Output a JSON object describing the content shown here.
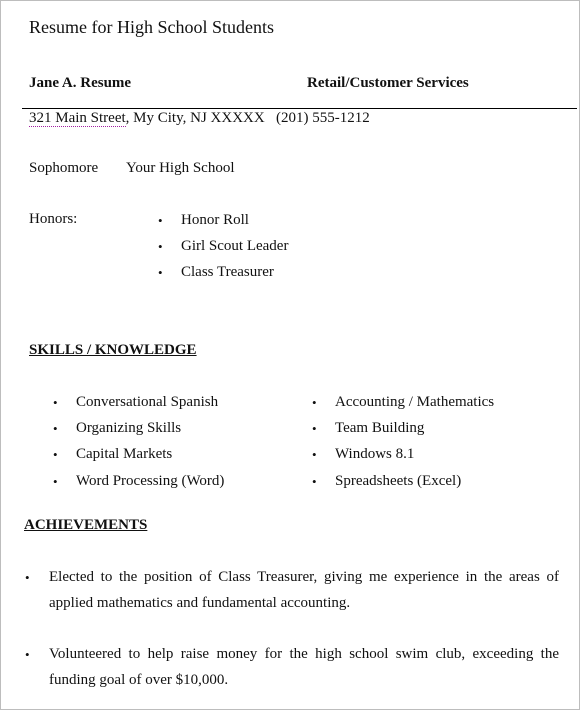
{
  "document": {
    "title": "Resume for High School Students",
    "name": "Jane A. Resume",
    "target_role": "Retail/Customer Services",
    "address": {
      "street": "321 Main Street",
      "rest": ", My City, NJ XXXXX",
      "phone": "(201) 555-1212"
    },
    "grade": "Sophomore",
    "school": "Your High School",
    "honors": {
      "label": "Honors:",
      "items": [
        "Honor Roll",
        "Girl Scout Leader",
        "Class Treasurer"
      ]
    },
    "skills": {
      "heading": "SKILLS / KNOWLEDGE",
      "left": [
        "Conversational Spanish",
        "Organizing Skills",
        "Capital Markets",
        "Word Processing (Word)"
      ],
      "right": [
        "Accounting / Mathematics",
        "Team Building",
        "Windows 8.1",
        "Spreadsheets (Excel)"
      ]
    },
    "achievements": {
      "heading": "ACHIEVEMENTS",
      "items": [
        "Elected to the position of Class Treasurer, giving me experience in the areas of applied mathematics and fundamental accounting.",
        "Volunteered to help raise money for the high school swim club, exceeding the funding goal of over $10,000."
      ]
    },
    "bullet_glyph": "•"
  }
}
